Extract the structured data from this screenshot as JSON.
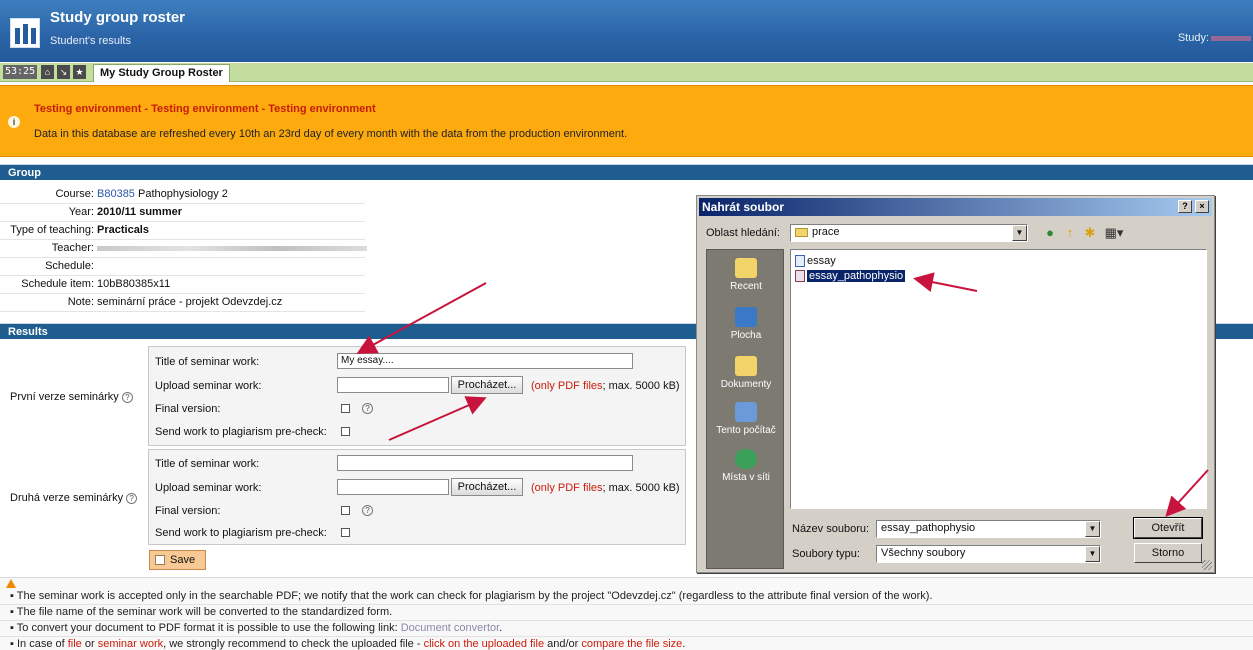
{
  "header": {
    "title": "Study group roster",
    "subtitle": "Student's results",
    "study_label": "Study:"
  },
  "tabbar": {
    "timer": "53:25",
    "active_tab": "My Study Group Roster"
  },
  "warning": {
    "title": "Testing environment - Testing environment - Testing environment",
    "body": "Data in this database are refreshed every 10th an 23rd day of every month with the data from the production environment."
  },
  "group": {
    "section_title": "Group",
    "rows": [
      {
        "label": "Course:",
        "code": "B80385",
        "value": "Pathophysiology 2"
      },
      {
        "label": "Year:",
        "value": "2010/11 summer"
      },
      {
        "label": "Type of teaching:",
        "value": "Practicals"
      },
      {
        "label": "Teacher:",
        "value": ""
      },
      {
        "label": "Schedule:",
        "value": ""
      },
      {
        "label": "Schedule item:",
        "value": "10bB80385x11"
      },
      {
        "label": "Note:",
        "value": "seminární práce - projekt Odevzdej.cz"
      }
    ]
  },
  "results": {
    "section_title": "Results",
    "versions": [
      {
        "label": "První verze seminárky",
        "title_label": "Title of seminar work:",
        "title_value": "My essay....",
        "upload_label": "Upload seminar work:",
        "browse_label": "Procházet...",
        "hint_red": "(only PDF files",
        "hint_rest": "; max. 5000 kB)",
        "final_label": "Final version:",
        "plagiarism_label": "Send work to plagiarism pre-check:"
      },
      {
        "label": "Druhá verze seminárky",
        "title_label": "Title of seminar work:",
        "title_value": "",
        "upload_label": "Upload seminar work:",
        "browse_label": "Procházet...",
        "hint_red": "(only PDF files",
        "hint_rest": "; max. 5000 kB)",
        "final_label": "Final version:",
        "plagiarism_label": "Send work to plagiarism pre-check:"
      }
    ],
    "save_label": "Save"
  },
  "notes": {
    "line1": "The seminar work is accepted only in the searchable PDF; we notify that the work can check for plagiarism by the project \"Odevzdej.cz\" (regardless to the attribute final version of the work).",
    "line2": "The file name of the seminar work will be converted to the standardized form.",
    "line3_prefix": "To convert your document to PDF format it is possible to use the following link:",
    "line3_link": "Document convertor",
    "line3_suffix": ".",
    "line4_a": "In case of",
    "line4_file": "file",
    "line4_b": "or",
    "line4_seminar": "seminar work",
    "line4_c": ", we strongly recommend to check the uploaded file -",
    "line4_click": "click on the uploaded file",
    "line4_d": "and/or",
    "line4_compare": "compare the file size",
    "line4_e": "."
  },
  "dialog": {
    "title": "Nahrát soubor",
    "help_btn": "?",
    "close_btn": "×",
    "look_in_label": "Oblast hledání:",
    "look_in_value": "prace",
    "places": [
      "Recent",
      "Plocha",
      "Dokumenty",
      "Tento počítač",
      "Místa v síti"
    ],
    "files": [
      "essay",
      "essay_pathophysio"
    ],
    "selected_file": "essay_pathophysio",
    "filename_label": "Název souboru:",
    "filename_value": "essay_pathophysio",
    "filetype_label": "Soubory typu:",
    "filetype_value": "Všechny soubory",
    "open_label": "Otevřít",
    "cancel_label": "Storno"
  },
  "colors": {
    "header_blue": "#2a64a6",
    "section_blue": "#1f5c8f",
    "warning_orange": "#fcaa0e",
    "warning_red": "#c81c0a",
    "link_blue": "#2b57a8",
    "annotation_arrow": "#c8143c"
  }
}
